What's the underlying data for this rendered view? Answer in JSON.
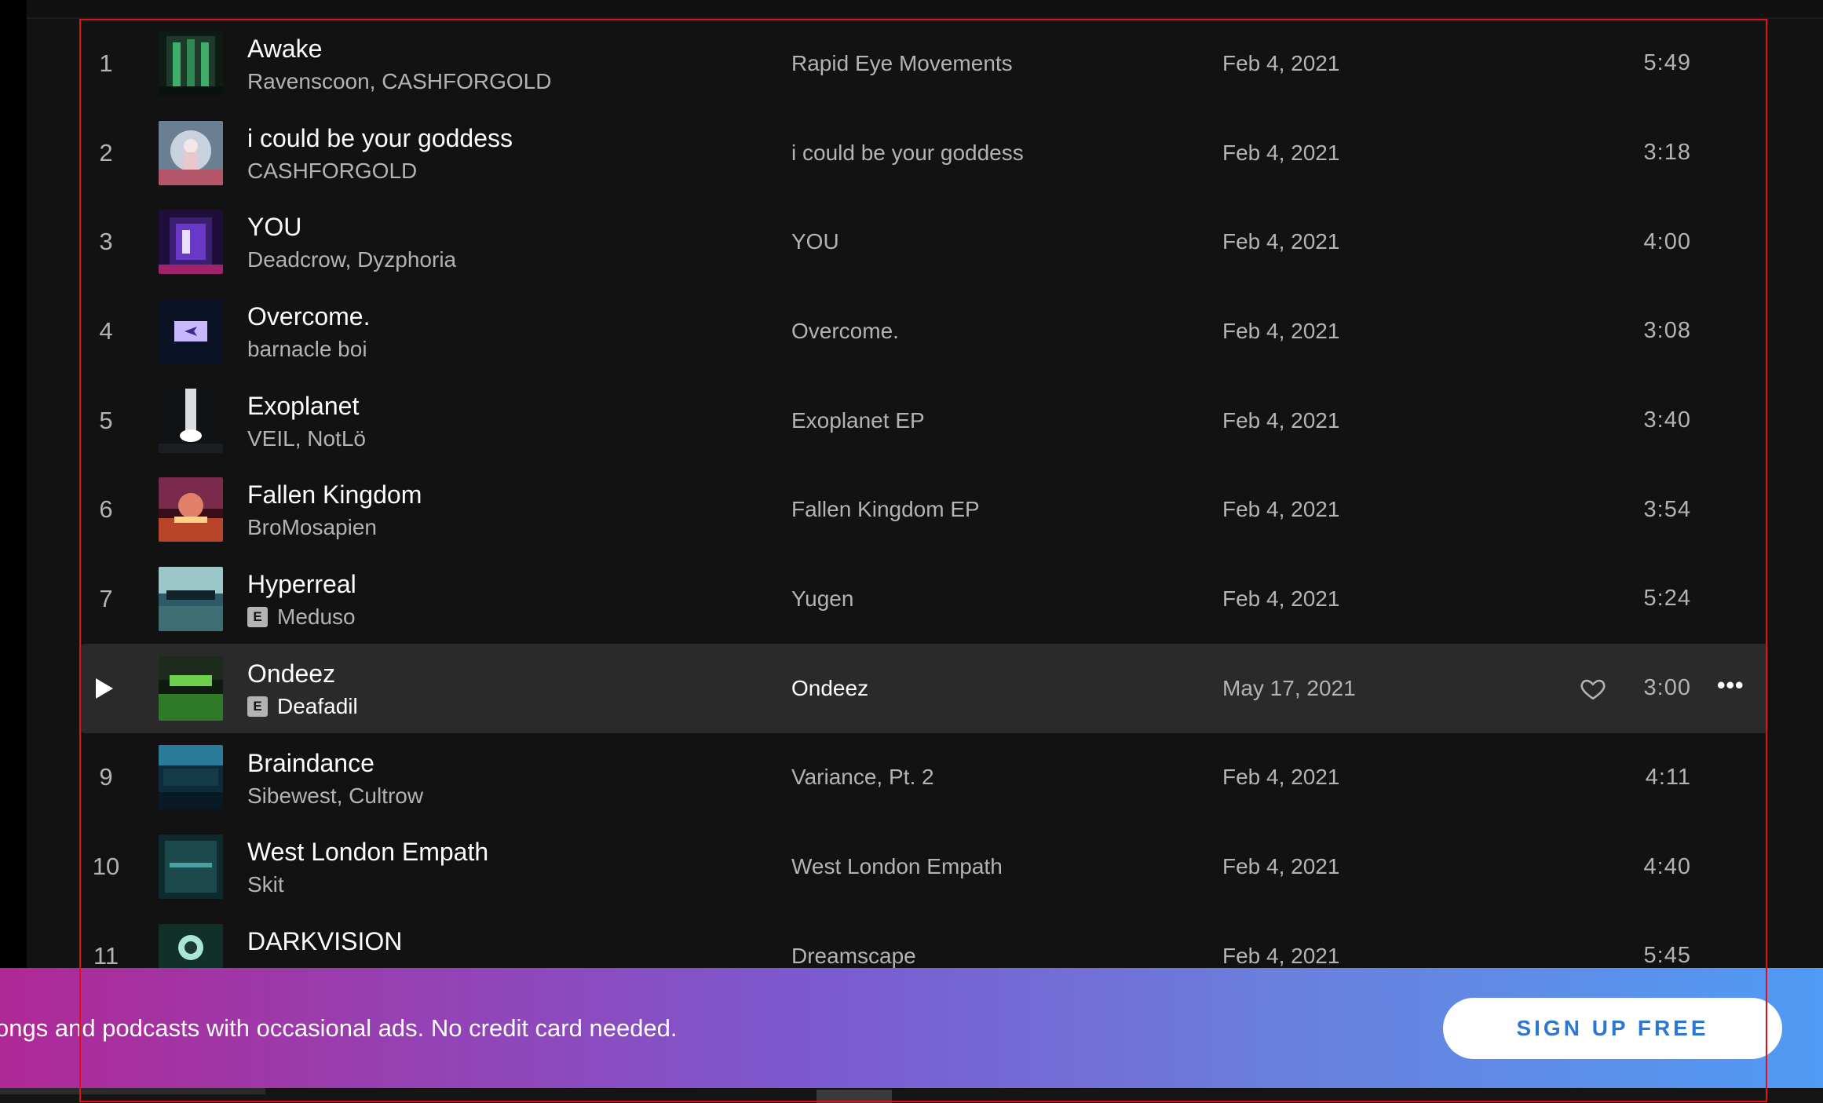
{
  "tracks": [
    {
      "num": "1",
      "title": "Awake",
      "explicit": false,
      "artists": "Ravenscoon, CASHFORGOLD",
      "album": "Rapid Eye Movements",
      "date": "Feb 4, 2021",
      "duration": "5:49",
      "active": false,
      "cover": "cover-awake"
    },
    {
      "num": "2",
      "title": "i could be your goddess",
      "explicit": false,
      "artists": "CASHFORGOLD",
      "album": "i could be your goddess",
      "date": "Feb 4, 2021",
      "duration": "3:18",
      "active": false,
      "cover": "cover-goddess"
    },
    {
      "num": "3",
      "title": "YOU",
      "explicit": false,
      "artists": "Deadcrow, Dyzphoria",
      "album": "YOU",
      "date": "Feb 4, 2021",
      "duration": "4:00",
      "active": false,
      "cover": "cover-you"
    },
    {
      "num": "4",
      "title": "Overcome.",
      "explicit": false,
      "artists": "barnacle boi",
      "album": "Overcome.",
      "date": "Feb 4, 2021",
      "duration": "3:08",
      "active": false,
      "cover": "cover-overcome"
    },
    {
      "num": "5",
      "title": "Exoplanet",
      "explicit": false,
      "artists": "VEIL, NotLö",
      "album": "Exoplanet EP",
      "date": "Feb 4, 2021",
      "duration": "3:40",
      "active": false,
      "cover": "cover-exoplanet"
    },
    {
      "num": "6",
      "title": "Fallen Kingdom",
      "explicit": false,
      "artists": "BroMosapien",
      "album": "Fallen Kingdom EP",
      "date": "Feb 4, 2021",
      "duration": "3:54",
      "active": false,
      "cover": "cover-fallen-kingdom"
    },
    {
      "num": "7",
      "title": "Hyperreal",
      "explicit": true,
      "artists": "Meduso",
      "album": "Yugen",
      "date": "Feb 4, 2021",
      "duration": "5:24",
      "active": false,
      "cover": "cover-yugen"
    },
    {
      "num": "8",
      "title": "Ondeez",
      "explicit": true,
      "artists": "Deafadil",
      "album": "Ondeez",
      "date": "May 17, 2021",
      "duration": "3:00",
      "active": true,
      "cover": "cover-ondeez"
    },
    {
      "num": "9",
      "title": "Braindance",
      "explicit": false,
      "artists": "Sibewest, Cultrow",
      "album": "Variance, Pt. 2",
      "date": "Feb 4, 2021",
      "duration": "4:11",
      "active": false,
      "cover": "cover-variance"
    },
    {
      "num": "10",
      "title": "West London Empath",
      "explicit": false,
      "artists": "Skit",
      "album": "West London Empath",
      "date": "Feb 4, 2021",
      "duration": "4:40",
      "active": false,
      "cover": "cover-west-london"
    },
    {
      "num": "11",
      "title": "DARKVISION",
      "explicit": false,
      "artists": "",
      "album": "Dreamscape",
      "date": "Feb 4, 2021",
      "duration": "5:45",
      "active": false,
      "cover": "cover-dreamscape"
    }
  ],
  "explicit_badge": "E",
  "more_icon": "•••",
  "banner": {
    "text": "ongs and podcasts with occasional ads. No credit card needed.",
    "button_label": "SIGN UP FREE"
  },
  "colors": {
    "background": "#121212",
    "active_row": "#2a2a2a",
    "secondary_text": "#b3b3b3",
    "banner_start": "#af2896",
    "banner_end": "#509bf5",
    "button_text": "#2e77d0",
    "highlight_border": "#e0101a"
  },
  "icons": {
    "play": "play-icon",
    "heart": "heart-icon",
    "more": "more-options-icon"
  }
}
